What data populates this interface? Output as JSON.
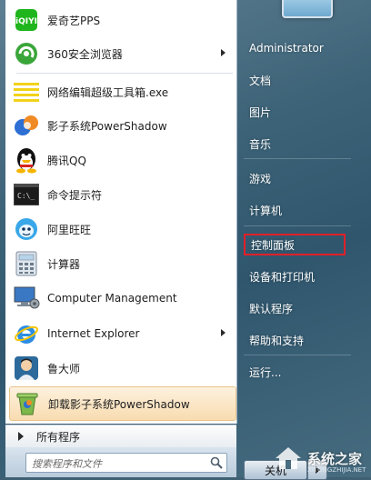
{
  "programs": [
    {
      "label": "爱奇艺PPS",
      "icon": "iqiyi-icon",
      "has_submenu": false
    },
    {
      "label": "360安全浏览器",
      "icon": "360-browser-icon",
      "has_submenu": true
    },
    {
      "label": "网络编辑超级工具箱.exe",
      "icon": "document-lines-icon",
      "has_submenu": false
    },
    {
      "label": "影子系统PowerShadow",
      "icon": "powershadow-icon",
      "has_submenu": false
    },
    {
      "label": "腾讯QQ",
      "icon": "qq-penguin-icon",
      "has_submenu": false
    },
    {
      "label": "命令提示符",
      "icon": "cmd-icon",
      "has_submenu": false
    },
    {
      "label": "阿里旺旺",
      "icon": "aliwangwang-icon",
      "has_submenu": false
    },
    {
      "label": "计算器",
      "icon": "calculator-icon",
      "has_submenu": false
    },
    {
      "label": "Computer Management",
      "icon": "computer-management-icon",
      "has_submenu": false
    },
    {
      "label": "Internet Explorer",
      "icon": "ie-icon",
      "has_submenu": true
    },
    {
      "label": "鲁大师",
      "icon": "ludashi-icon",
      "has_submenu": false
    },
    {
      "label": "卸载影子系统PowerShadow",
      "icon": "uninstall-icon",
      "has_submenu": false,
      "highlighted": true
    }
  ],
  "all_programs_label": "所有程序",
  "search": {
    "placeholder": "搜索程序和文件"
  },
  "right_panel": {
    "items": [
      {
        "label": "Administrator"
      },
      {
        "label": "文档"
      },
      {
        "label": "图片"
      },
      {
        "label": "音乐"
      },
      {
        "label": "游戏"
      },
      {
        "label": "计算机"
      },
      {
        "label": "控制面板",
        "highlighted_box": true
      },
      {
        "label": "设备和打印机"
      },
      {
        "label": "默认程序"
      },
      {
        "label": "帮助和支持"
      },
      {
        "label": "运行..."
      }
    ]
  },
  "shutdown_label": "关机",
  "watermark": {
    "text": "系统之家",
    "sub": "XITONGZHIJIA.NET"
  },
  "colors": {
    "highlight_box": "#e0202a",
    "hover_item": "#f8dcb0",
    "panel_bg": "#ffffff"
  }
}
